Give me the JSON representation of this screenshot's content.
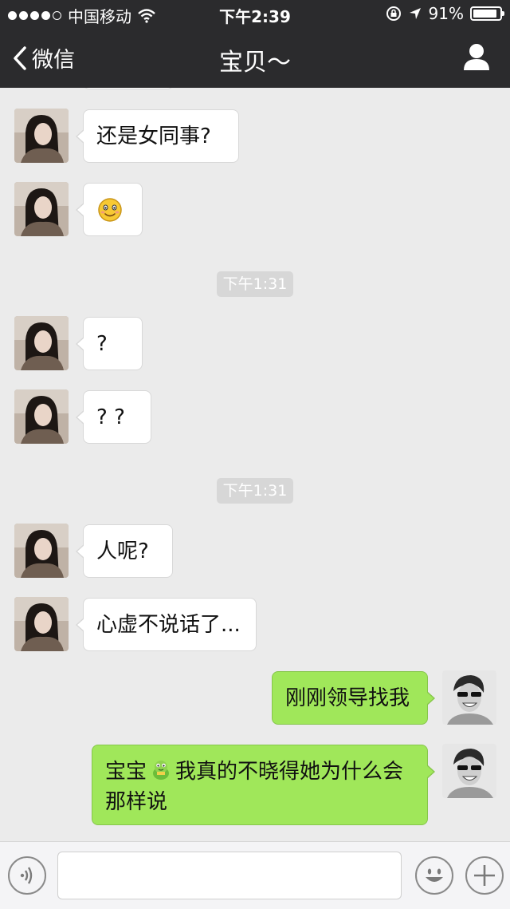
{
  "status_bar": {
    "carrier": "中国移动",
    "time": "下午2:39",
    "battery": "91%",
    "battery_level": 0.91,
    "signal_dots_filled": 4
  },
  "nav": {
    "back_label": "微信",
    "title": "宝贝～"
  },
  "messages": [
    {
      "type": "in",
      "text": "还是女同事?"
    },
    {
      "type": "in",
      "text": ""
    },
    {
      "type": "time",
      "text": "下午1:31"
    },
    {
      "type": "in",
      "text": "?"
    },
    {
      "type": "in",
      "text": "? ?"
    },
    {
      "type": "time",
      "text": "下午1:31"
    },
    {
      "type": "in",
      "text": "人呢?"
    },
    {
      "type": "in",
      "text": "心虚不说话了..."
    },
    {
      "type": "out",
      "text": "刚刚领导找我"
    },
    {
      "type": "out",
      "text_before_emoji": "宝宝",
      "text_line1": "我真的不晓得她为什么会",
      "text_line2": "那样说"
    }
  ],
  "colors": {
    "nav_bg": "#2b2b2d",
    "chat_bg": "#ebebeb",
    "out_bubble": "#a0e75a",
    "in_bubble": "#ffffff"
  },
  "icons": {
    "back": "chevron-left-icon",
    "profile": "user-icon",
    "voice": "voice-icon",
    "emoji": "emoji-icon",
    "more": "plus-icon"
  }
}
